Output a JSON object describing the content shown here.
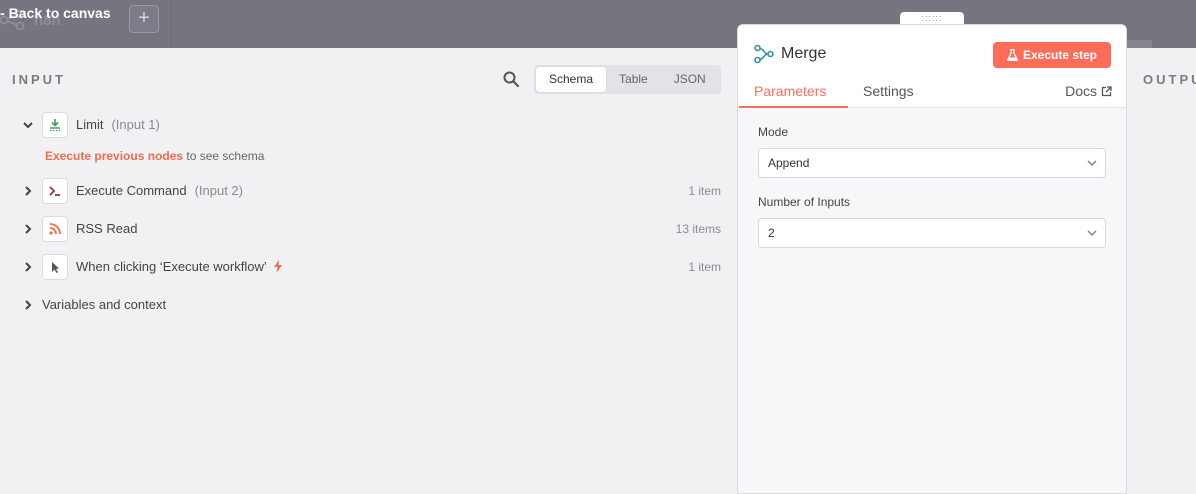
{
  "topbar": {
    "back_label": "Back to canvas",
    "workflow_name_partial": "n8n",
    "add_label": "+"
  },
  "input_panel": {
    "title": "INPUT",
    "view_tabs": [
      {
        "label": "Schema",
        "active": true
      },
      {
        "label": "Table",
        "active": false
      },
      {
        "label": "JSON",
        "active": false
      }
    ],
    "nodes": [
      {
        "name": "Limit",
        "sub": "(Input 1)",
        "count": "",
        "icon": "limit-icon",
        "expanded": true
      },
      {
        "name": "Execute Command",
        "sub": "(Input 2)",
        "count": "1 item",
        "icon": "terminal-icon",
        "expanded": false
      },
      {
        "name": "RSS Read",
        "sub": "",
        "count": "13 items",
        "icon": "rss-icon",
        "expanded": false
      },
      {
        "name": "When clicking ‘Execute workflow’",
        "sub": "",
        "count": "1 item",
        "icon": "cursor-icon",
        "expanded": false
      }
    ],
    "hint_link": "Execute previous nodes",
    "hint_text": " to see schema",
    "variables_label": "Variables and context"
  },
  "param_panel": {
    "drag_handle": "::::::",
    "title": "Merge",
    "execute_label": "Execute step",
    "tabs": {
      "parameters": "Parameters",
      "settings": "Settings",
      "docs": "Docs"
    },
    "mode_label": "Mode",
    "mode_value": "Append",
    "inputs_label": "Number of Inputs",
    "inputs_value": "2"
  },
  "output_panel": {
    "title": "OUTPU"
  },
  "colors": {
    "accent": "#ff6d5a",
    "link": "#f26b52",
    "merge_icon": "#3a8fa8"
  }
}
